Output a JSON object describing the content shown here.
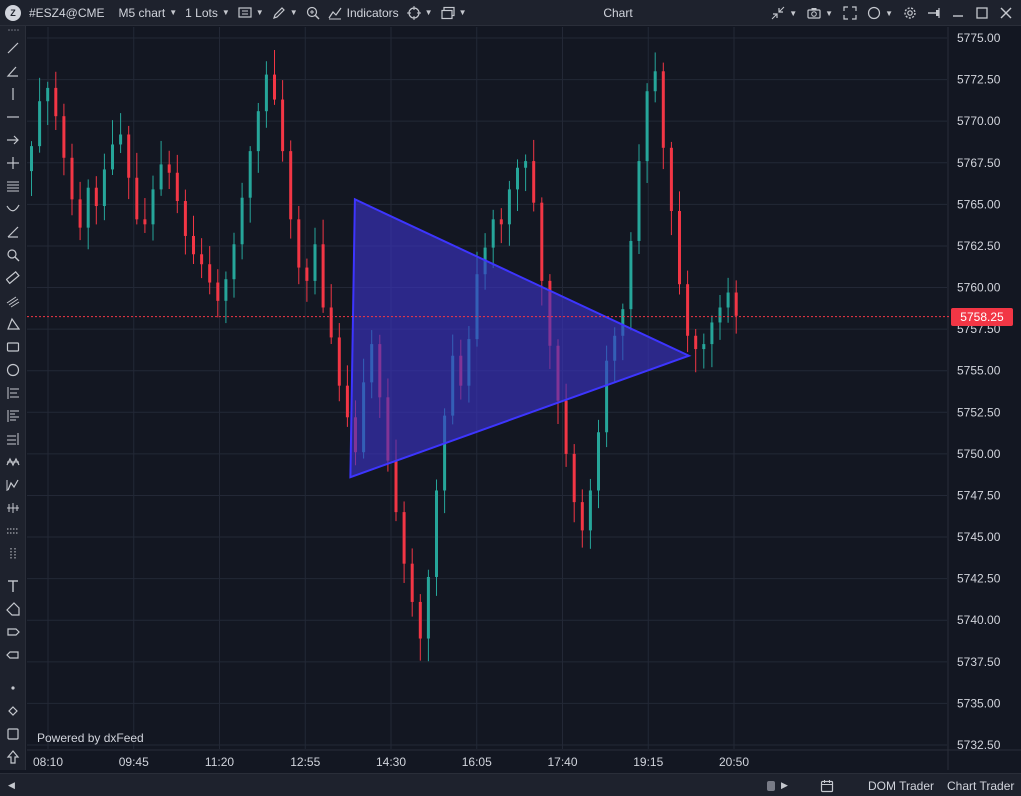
{
  "toolbar": {
    "symbol": "#ESZ4@CME",
    "timeframe": "M5 chart",
    "lots": "1 Lots",
    "indicators": "Indicators",
    "window_title": "Chart"
  },
  "footer": {
    "powered_by": "Powered by dxFeed",
    "dom_trader": "DOM Trader",
    "chart_trader": "Chart Trader"
  },
  "current_price": "5758.25",
  "colors": {
    "background": "#131722",
    "up_candle": "#26a69a",
    "down_candle": "#f23645",
    "triangle_stroke": "#3d35ff",
    "triangle_fill": "#3b34c8"
  },
  "icons": [
    "logo-icon",
    "chart-type-icon",
    "pencil-icon",
    "zoom-icon",
    "indicators-icon",
    "crosshair-icon",
    "layout-icon",
    "shrink-icon",
    "camera-icon",
    "fullscreen-icon",
    "theme-icon",
    "gear-icon",
    "pin-icon",
    "minimize-icon",
    "maximize-icon",
    "close-icon",
    "calendar-icon"
  ],
  "chart_data": {
    "type": "candlestick",
    "y_axis": {
      "ticks": [
        "5775.00",
        "5772.50",
        "5770.00",
        "5767.50",
        "5765.00",
        "5762.50",
        "5760.00",
        "5757.50",
        "5755.00",
        "5752.50",
        "5750.00",
        "5747.50",
        "5745.00",
        "5742.50",
        "5740.00",
        "5737.50",
        "5735.00",
        "5732.50"
      ],
      "ylim": [
        5731.5,
        5776
      ]
    },
    "x_axis": {
      "ticks": [
        "08:10",
        "09:45",
        "11:20",
        "12:55",
        "14:30",
        "16:05",
        "17:40",
        "19:15",
        "20:50"
      ]
    },
    "grid": true,
    "current_price_line": 5758.25,
    "drawing": {
      "shape": "triangle",
      "vertices": [
        {
          "t": "13:50",
          "price": 5765.3
        },
        {
          "t": "13:45",
          "price": 5748.6
        },
        {
          "t": "20:00",
          "price": 5755.9
        }
      ]
    },
    "closes": [
      5768.5,
      5771.2,
      5772.0,
      5770.3,
      5767.8,
      5765.3,
      5763.6,
      5766.0,
      5764.9,
      5767.1,
      5768.6,
      5769.2,
      5766.6,
      5764.1,
      5763.8,
      5765.9,
      5767.4,
      5766.9,
      5765.2,
      5763.1,
      5762.0,
      5761.4,
      5760.3,
      5759.2,
      5760.5,
      5762.6,
      5765.4,
      5768.2,
      5770.6,
      5772.8,
      5771.3,
      5768.2,
      5764.1,
      5761.2,
      5760.4,
      5762.6,
      5758.8,
      5757.0,
      5754.1,
      5752.2,
      5750.1,
      5754.3,
      5756.6,
      5753.4,
      5749.6,
      5746.5,
      5743.4,
      5741.1,
      5738.9,
      5742.6,
      5747.8,
      5752.3,
      5755.9,
      5754.1,
      5756.9,
      5760.8,
      5762.4,
      5764.1,
      5763.8,
      5765.9,
      5767.2,
      5767.6,
      5765.1,
      5760.4,
      5756.5,
      5753.2,
      5750.0,
      5747.1,
      5745.4,
      5747.8,
      5751.3,
      5755.6,
      5757.1,
      5758.7,
      5762.8,
      5767.6,
      5771.8,
      5773.0,
      5768.4,
      5764.6,
      5760.2,
      5757.1,
      5756.3,
      5756.6,
      5757.9,
      5758.8,
      5759.7,
      5758.3
    ]
  }
}
